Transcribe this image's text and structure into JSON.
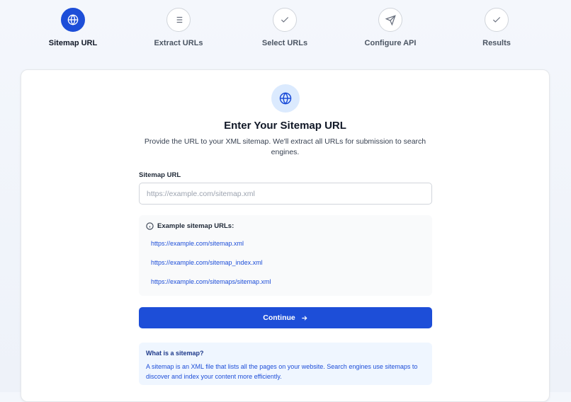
{
  "stepper": {
    "steps": [
      {
        "label": "Sitemap URL",
        "icon": "globe-icon",
        "active": true
      },
      {
        "label": "Extract URLs",
        "icon": "list-icon",
        "active": false
      },
      {
        "label": "Select URLs",
        "icon": "check-icon",
        "active": false
      },
      {
        "label": "Configure API",
        "icon": "send-icon",
        "active": false
      },
      {
        "label": "Results",
        "icon": "check-icon",
        "active": false
      }
    ]
  },
  "card": {
    "icon": "globe-icon",
    "title": "Enter Your Sitemap URL",
    "subtitle": "Provide the URL to your XML sitemap. We'll extract all URLs for submission to search engines.",
    "field_label": "Sitemap URL",
    "input": {
      "value": "",
      "placeholder": "https://example.com/sitemap.xml"
    },
    "examples": {
      "heading": "Example sitemap URLs:",
      "icon": "info-icon",
      "links": [
        "https://example.com/sitemap.xml",
        "https://example.com/sitemap_index.xml",
        "https://example.com/sitemaps/sitemap.xml"
      ]
    },
    "continue_label": "Continue",
    "info": {
      "title": "What is a sitemap?",
      "text": "A sitemap is an XML file that lists all the pages on your website. Search engines use sitemaps to discover and index your content more efficiently."
    }
  },
  "colors": {
    "accent": "#1d4ed8",
    "accent_light": "#dbeafe",
    "info_bg": "#eff6ff",
    "examples_bg": "#f9fafb"
  }
}
